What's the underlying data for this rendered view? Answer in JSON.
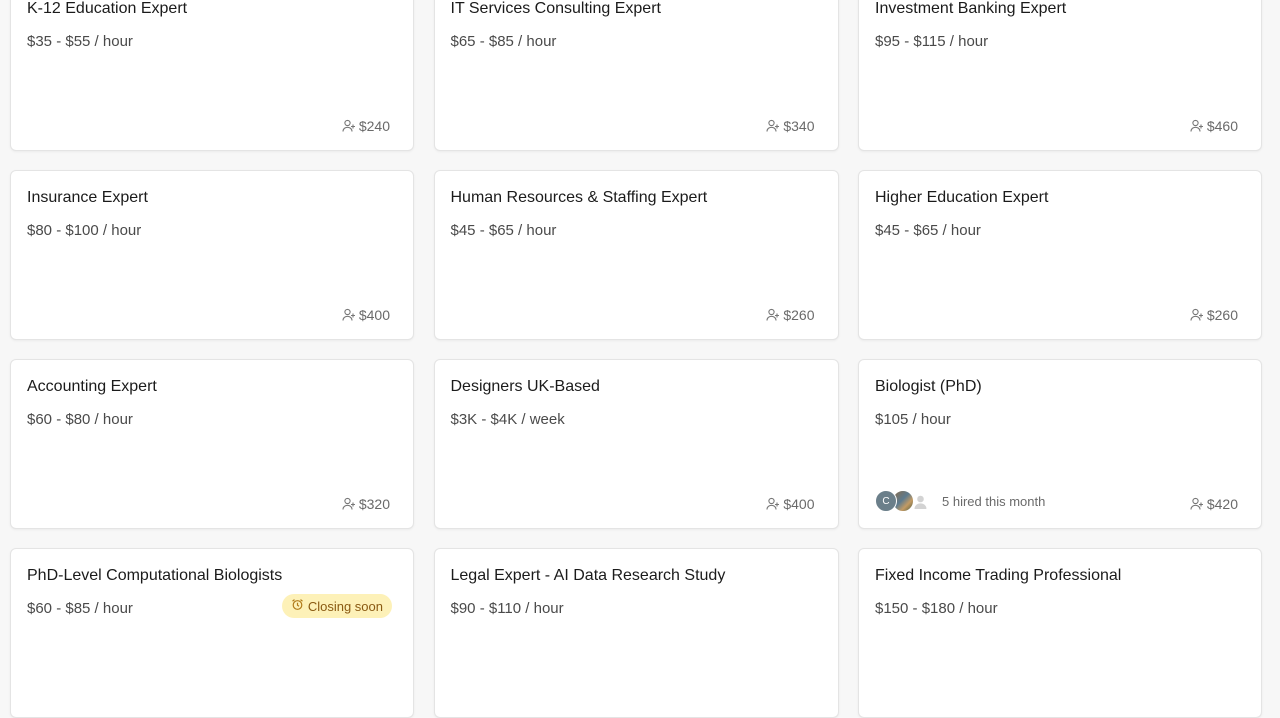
{
  "cards": [
    {
      "title": "K-12 Education Expert",
      "rate": "$35 - $55 / hour",
      "fee": "$240"
    },
    {
      "title": "IT Services Consulting Expert",
      "rate": "$65 - $85 / hour",
      "fee": "$340"
    },
    {
      "title": "Investment Banking Expert",
      "rate": "$95 - $115 / hour",
      "fee": "$460"
    },
    {
      "title": "Insurance Expert",
      "rate": "$80 - $100 / hour",
      "fee": "$400"
    },
    {
      "title": "Human Resources & Staffing Expert",
      "rate": "$45 - $65 / hour",
      "fee": "$260"
    },
    {
      "title": "Higher Education Expert",
      "rate": "$45 - $65 / hour",
      "fee": "$260"
    },
    {
      "title": "Accounting Expert",
      "rate": "$60 - $80 / hour",
      "fee": "$320"
    },
    {
      "title": "Designers UK-Based",
      "rate": "$3K - $4K / week",
      "fee": "$400"
    },
    {
      "title": "Biologist (PhD)",
      "rate": "$105 / hour",
      "fee": "$420",
      "hired_text": "5 hired this month",
      "avatar_initial": "C"
    },
    {
      "title": "PhD-Level Computational Biologists",
      "rate": "$60 - $85 / hour",
      "badge": "Closing soon"
    },
    {
      "title": "Legal Expert - AI Data Research Study",
      "rate": "$90 - $110 / hour"
    },
    {
      "title": "Fixed Income Trading Professional",
      "rate": "$150 - $180 / hour"
    }
  ],
  "icons": {
    "fee": "user-plus-icon",
    "badge": "alarm-clock-icon"
  },
  "colors": {
    "badge_bg": "#fdf1b8",
    "badge_text": "#8a5a12"
  }
}
